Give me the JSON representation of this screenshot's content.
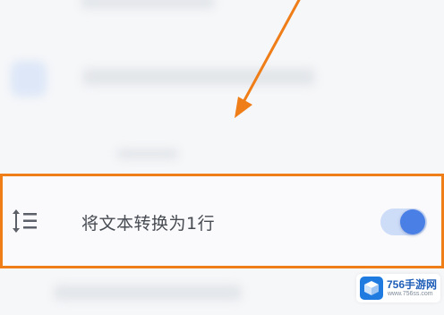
{
  "setting": {
    "label": "将文本转换为1行",
    "icon": "line-height-icon",
    "toggle_state": "on"
  },
  "watermark": {
    "name": "756手游网",
    "url": "www.756ss.com"
  },
  "colors": {
    "highlight_border": "#ef7d18",
    "arrow": "#ef7d18",
    "toggle_knob": "#4a7fe6",
    "toggle_track": "#cddcf7",
    "label_text": "#474b52"
  }
}
